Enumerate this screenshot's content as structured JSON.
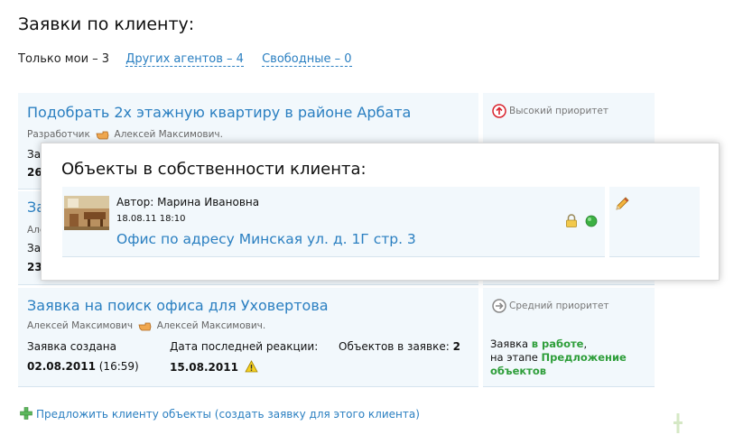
{
  "page_title": "Заявки по клиенту:",
  "filters": {
    "current": "Только мои – 3",
    "others": "Других агентов – 4",
    "free": "Свободные – 0"
  },
  "requests": [
    {
      "title": "Подобрать 2х этажную квартиру в районе Арбата",
      "role": "Разработчик",
      "agent": "Алексей Максимович.",
      "created_label_partial": "Заяв",
      "created_value_partial": "26",
      "priority": "Высокий приоритет"
    },
    {
      "title_partial": "За",
      "meta_partial": "Алекс",
      "created_label_partial": "Зая",
      "created_value_partial": "23"
    },
    {
      "title": "Заявка на поиск офиса для Уховертова",
      "from_agent": "Алексей Максимович",
      "to_agent": "Алексей Максимович.",
      "created_label": "Заявка создана",
      "created_date": "02.08.2011",
      "created_time": "(16:59)",
      "last_reaction_label": "Дата последней реакции:",
      "last_reaction_date": "15.08.2011",
      "objects_label": "Объектов в заявке:",
      "objects_count": "2",
      "priority": "Средний приоритет",
      "status_prefix": "Заявка",
      "status_value": "в работе",
      "status_comma": ",",
      "stage_prefix": "на этапе",
      "stage_value": "Предложение объектов"
    }
  ],
  "popup": {
    "title": "Объекты в собственности клиента:",
    "object": {
      "author": "Автор: Марина Ивановна",
      "date": "18.08.11 18:10",
      "title": "Офис по адресу Минская ул. д. 1Г стр. 3"
    }
  },
  "footer": {
    "link": "Предложить клиенту объекты (создать заявку для этого клиента)"
  },
  "colors": {
    "link": "#2a7fc1",
    "card_bg": "#f2f8fc",
    "high_priority": "#d9232e",
    "status_green": "#2e9e3a"
  }
}
